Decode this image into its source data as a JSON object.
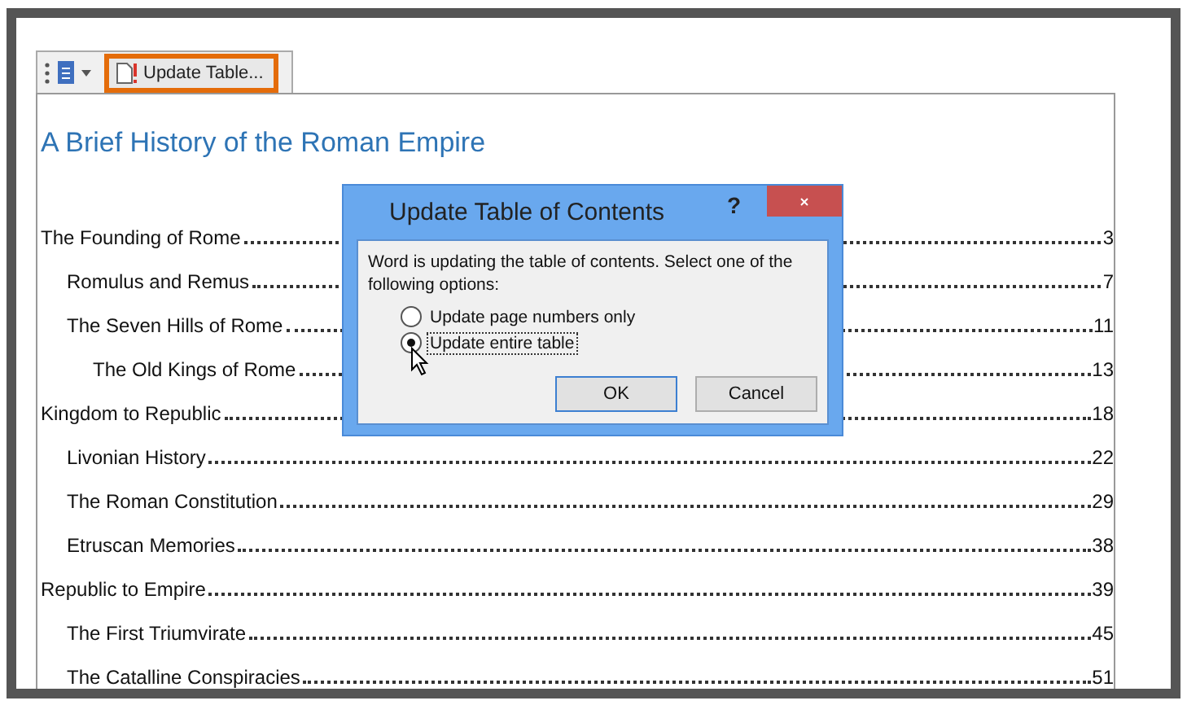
{
  "toolbar": {
    "update_button": "Update Table..."
  },
  "document": {
    "title": "A Brief History of the Roman Empire",
    "toc": [
      {
        "title": "The Founding of Rome",
        "page": "3",
        "children": [
          {
            "title": "Romulus and Remus",
            "page": "7"
          },
          {
            "title": "The Seven Hills of Rome",
            "page": "11",
            "children": [
              {
                "title": "The Old Kings of Rome",
                "page": "13"
              }
            ]
          }
        ]
      },
      {
        "title": "Kingdom to Republic",
        "page": "18",
        "children": [
          {
            "title": "Livonian History",
            "page": "22"
          },
          {
            "title": "The Roman Constitution",
            "page": "29"
          },
          {
            "title": "Etruscan Memories",
            "page": "38"
          }
        ]
      },
      {
        "title": "Republic to Empire",
        "page": "39",
        "children": [
          {
            "title": "The First Triumvirate",
            "page": "45"
          },
          {
            "title": "The Catalline Conspiracies",
            "page": "51"
          }
        ]
      }
    ]
  },
  "dialog": {
    "title": "Update Table of Contents",
    "help": "?",
    "message": "Word is updating the table of contents.  Select one of the following options:",
    "options": [
      {
        "label": "Update page numbers only",
        "selected": false
      },
      {
        "label": "Update entire table",
        "selected": true
      }
    ],
    "buttons": [
      {
        "label": "OK",
        "default": true
      },
      {
        "label": "Cancel",
        "default": false
      }
    ]
  }
}
